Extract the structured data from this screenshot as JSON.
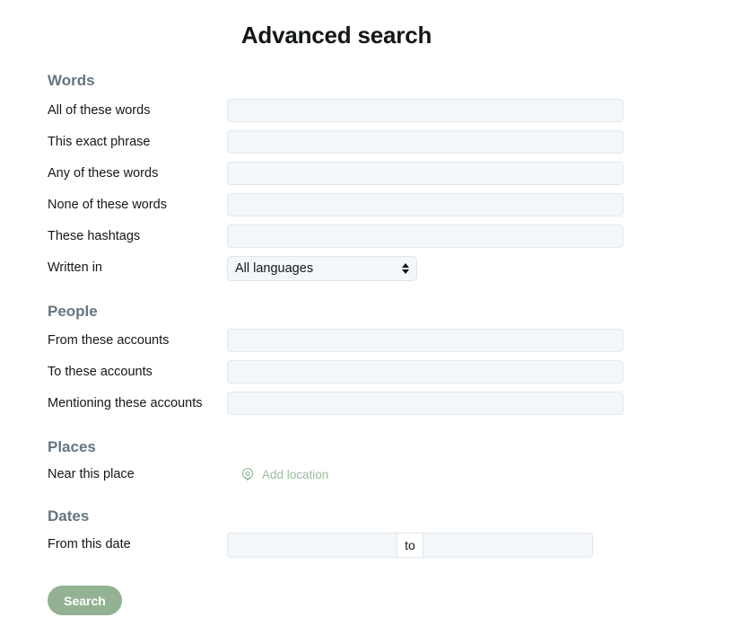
{
  "page": {
    "title": "Advanced search"
  },
  "theme": {
    "heading_color": "#66757f",
    "label_color": "#14171a",
    "field_bg": "#f3f7fa",
    "field_border": "#e1e8ed",
    "link_green": "#9cba9c",
    "button_green": "#93b193"
  },
  "sections": [
    {
      "id": "words",
      "heading": "Words",
      "rows": [
        {
          "id": "all-of-these-words",
          "label": "All of these words",
          "control": "text",
          "value": "",
          "placeholder": ""
        },
        {
          "id": "this-exact-phrase",
          "label": "This exact phrase",
          "control": "text",
          "value": "",
          "placeholder": ""
        },
        {
          "id": "any-of-these-words",
          "label": "Any of these words",
          "control": "text",
          "value": "",
          "placeholder": ""
        },
        {
          "id": "none-of-these-words",
          "label": "None of these words",
          "control": "text",
          "value": "",
          "placeholder": ""
        },
        {
          "id": "these-hashtags",
          "label": "These hashtags",
          "control": "text",
          "value": "",
          "placeholder": ""
        },
        {
          "id": "written-in",
          "label": "Written in",
          "control": "select",
          "value": "All languages"
        }
      ]
    },
    {
      "id": "people",
      "heading": "People",
      "rows": [
        {
          "id": "from-these-accounts",
          "label": "From these accounts",
          "control": "text",
          "value": "",
          "placeholder": ""
        },
        {
          "id": "to-these-accounts",
          "label": "To these accounts",
          "control": "text",
          "value": "",
          "placeholder": ""
        },
        {
          "id": "mentioning-these-accounts",
          "label": "Mentioning these accounts",
          "control": "text",
          "value": "",
          "placeholder": ""
        }
      ]
    },
    {
      "id": "places",
      "heading": "Places",
      "rows": [
        {
          "id": "near-this-place",
          "label": "Near this place",
          "control": "link",
          "link_label": "Add location",
          "icon": "location-pin-icon"
        }
      ]
    },
    {
      "id": "dates",
      "heading": "Dates",
      "rows": [
        {
          "id": "from-this-date",
          "label": "From this date",
          "control": "daterange",
          "separator": "to",
          "from_value": "",
          "to_value": "",
          "from_placeholder": "",
          "to_placeholder": ""
        }
      ]
    }
  ],
  "actions": {
    "search_label": "Search"
  }
}
